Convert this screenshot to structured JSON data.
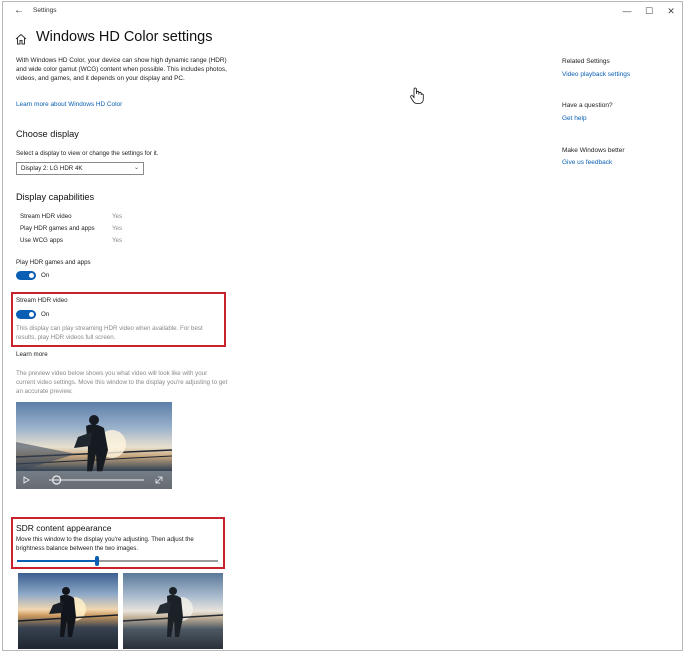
{
  "window": {
    "title": "Settings",
    "back_glyph": "←",
    "controls": {
      "minimize": "—",
      "maximize": "☐",
      "close": "✕"
    }
  },
  "header": {
    "title": "Windows HD Color settings",
    "intro": "With Windows HD Color, your device can show high dynamic range (HDR) and wide color gamut (WCG) content when possible. This includes photos, videos, and games, and it depends on your display and PC.",
    "learn_more_link": "Learn more about Windows HD Color"
  },
  "choose_display": {
    "heading": "Choose display",
    "instruction": "Select a display to view or change the settings for it.",
    "dropdown_value": "Display 2: LG HDR 4K"
  },
  "capabilities": {
    "heading": "Display capabilities",
    "rows": [
      {
        "label": "Stream HDR video",
        "value": "Yes"
      },
      {
        "label": "Play HDR games and apps",
        "value": "Yes"
      },
      {
        "label": "Use WCG apps",
        "value": "Yes"
      }
    ]
  },
  "play_hdr": {
    "label": "Play HDR games and apps",
    "state": "On"
  },
  "stream_hdr": {
    "label": "Stream HDR video",
    "state": "On",
    "description": "This display can play streaming HDR video when available. For best results, play HDR videos full screen.",
    "learn_more": "Learn more"
  },
  "preview": {
    "description": "The preview video below shows you what video will look like with your current video settings. Move this window to the display you're adjusting to get an accurate preview.",
    "progress": 0.08
  },
  "sdr": {
    "heading": "SDR content appearance",
    "description": "Move this window to the display you're adjusting. Then adjust the brightness balance between the two images.",
    "slider_value": 0.4
  },
  "related": {
    "heading": "Related Settings",
    "link": "Video playback settings"
  },
  "question": {
    "heading": "Have a question?",
    "link": "Get help"
  },
  "feedback": {
    "heading": "Make Windows better",
    "link": "Give us feedback"
  },
  "colors": {
    "accent": "#0a5fb4",
    "highlight_box": "#c8232c"
  },
  "icons": [
    "back-arrow-icon",
    "home-icon",
    "chevron-down-icon",
    "play-icon",
    "fullscreen-icon",
    "hand-cursor-icon"
  ]
}
